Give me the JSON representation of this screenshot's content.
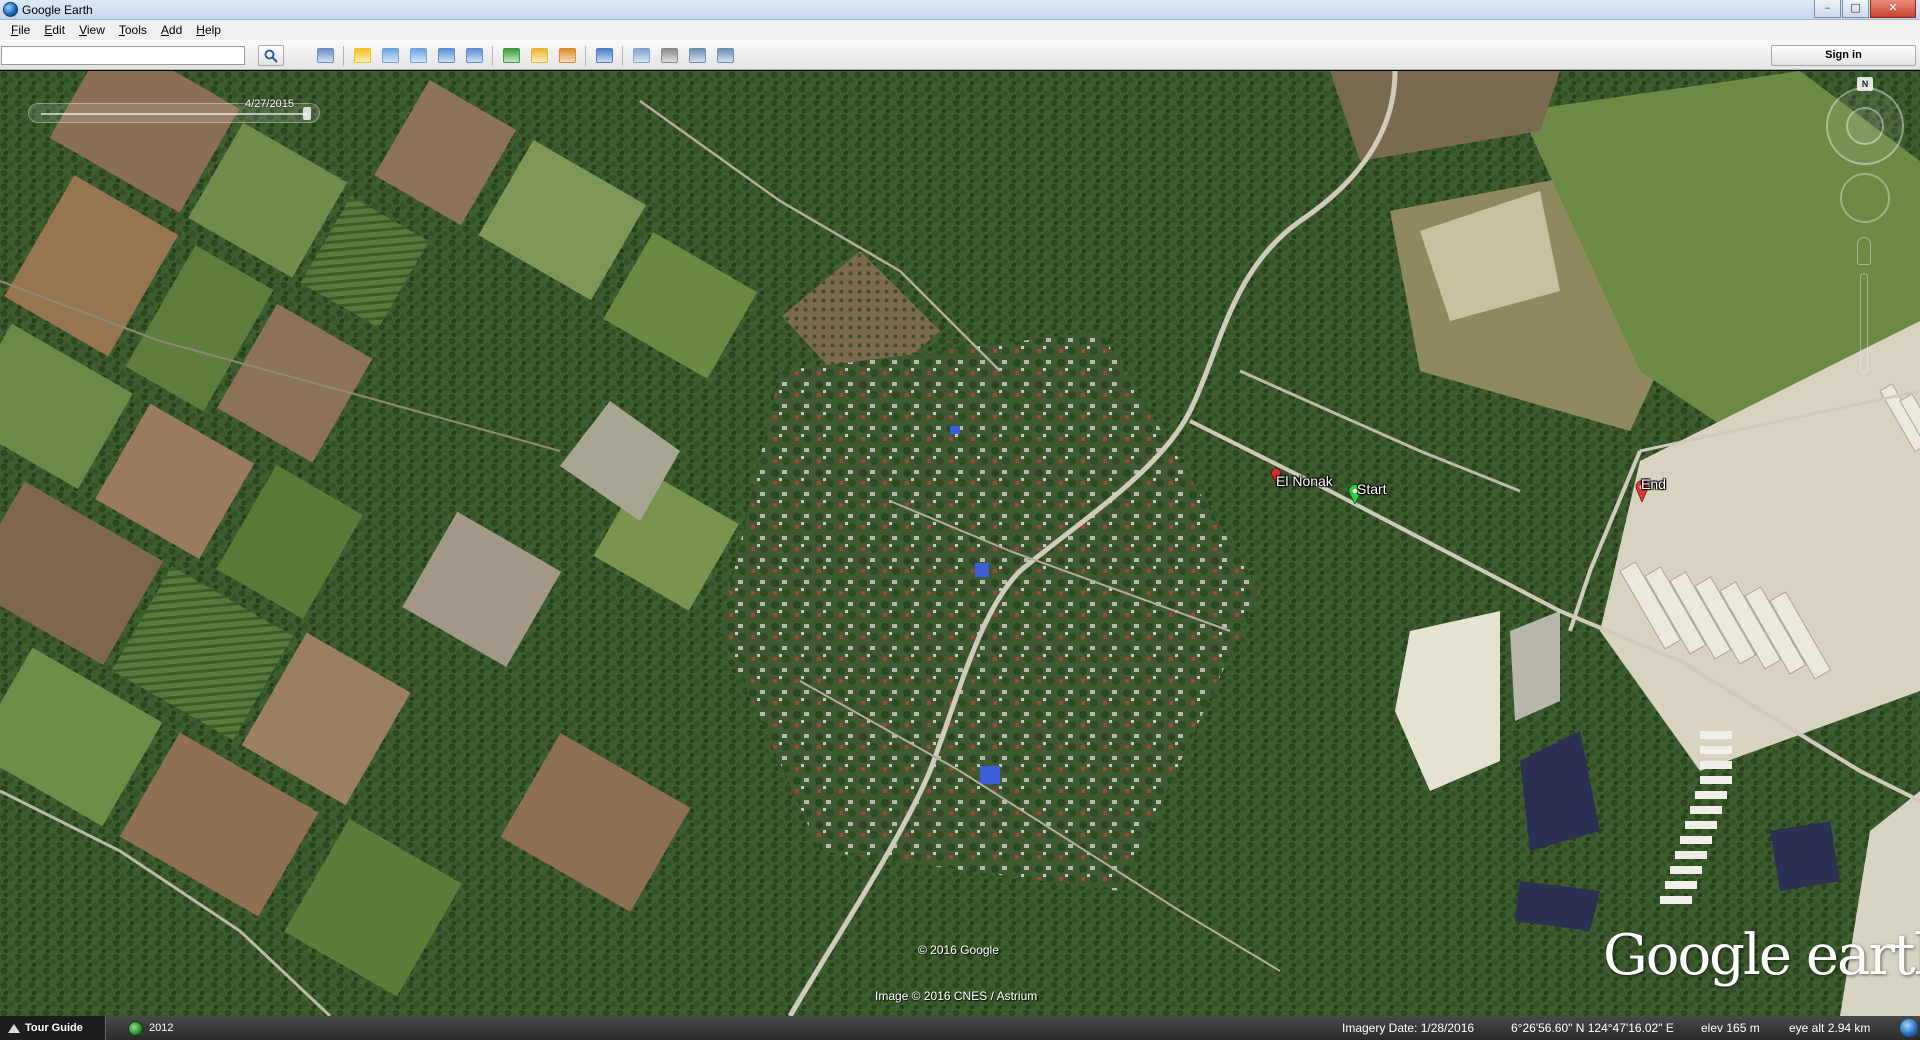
{
  "window": {
    "title": "Google Earth",
    "controls": {
      "minimize": "–",
      "maximize": "□",
      "close": "✕"
    }
  },
  "menu": {
    "items": [
      {
        "label": "File",
        "mnemonic": "F"
      },
      {
        "label": "Edit",
        "mnemonic": "E"
      },
      {
        "label": "View",
        "mnemonic": "V"
      },
      {
        "label": "Tools",
        "mnemonic": "T"
      },
      {
        "label": "Add",
        "mnemonic": "A"
      },
      {
        "label": "Help",
        "mnemonic": "H"
      }
    ]
  },
  "toolbar": {
    "search_value": "",
    "sign_in_label": "Sign in",
    "icons": [
      {
        "name": "sidebar-toggle-icon",
        "color": "#6a8fc4"
      },
      {
        "name": "add-placemark-icon",
        "color": "#f0c419"
      },
      {
        "name": "add-polygon-icon",
        "color": "#6fa3e0"
      },
      {
        "name": "add-path-icon",
        "color": "#6fa3e0"
      },
      {
        "name": "add-image-overlay-icon",
        "color": "#5b8fd4"
      },
      {
        "name": "record-tour-icon",
        "color": "#5b8fd4"
      },
      {
        "name": "historical-imagery-icon",
        "color": "#3a9b3a"
      },
      {
        "name": "sunlight-icon",
        "color": "#e8b530"
      },
      {
        "name": "switch-to-sky-icon",
        "color": "#e08a2a"
      },
      {
        "name": "ruler-icon",
        "color": "#4a7fc8"
      },
      {
        "name": "email-icon",
        "color": "#7ea3cf"
      },
      {
        "name": "print-icon",
        "color": "#8a8a8a"
      },
      {
        "name": "save-image-icon",
        "color": "#6b8fb5"
      },
      {
        "name": "view-in-maps-icon",
        "color": "#6b8fb5"
      }
    ]
  },
  "map": {
    "time_slider_date": "4/27/2015",
    "compass_north": "N",
    "placemarks": [
      {
        "label": "El Nonak",
        "color": "#d62b2b"
      },
      {
        "label": "Start",
        "color": "#2ccf3c"
      },
      {
        "label": "End",
        "color": "#e03a2e"
      }
    ],
    "copyright_top": "© 2016 Google",
    "copyright_bottom": "Image © 2016 CNES / Astrium",
    "logo_text": "Google earth"
  },
  "status": {
    "tour_guide_label": "Tour Guide",
    "year_label": "2012",
    "imagery_date": "Imagery Date: 1/28/2016",
    "coordinates": "6°26'56.60\" N  124°47'16.02\" E",
    "elevation": "elev   165 m",
    "eye_altitude": "eye alt   2.94 km"
  }
}
